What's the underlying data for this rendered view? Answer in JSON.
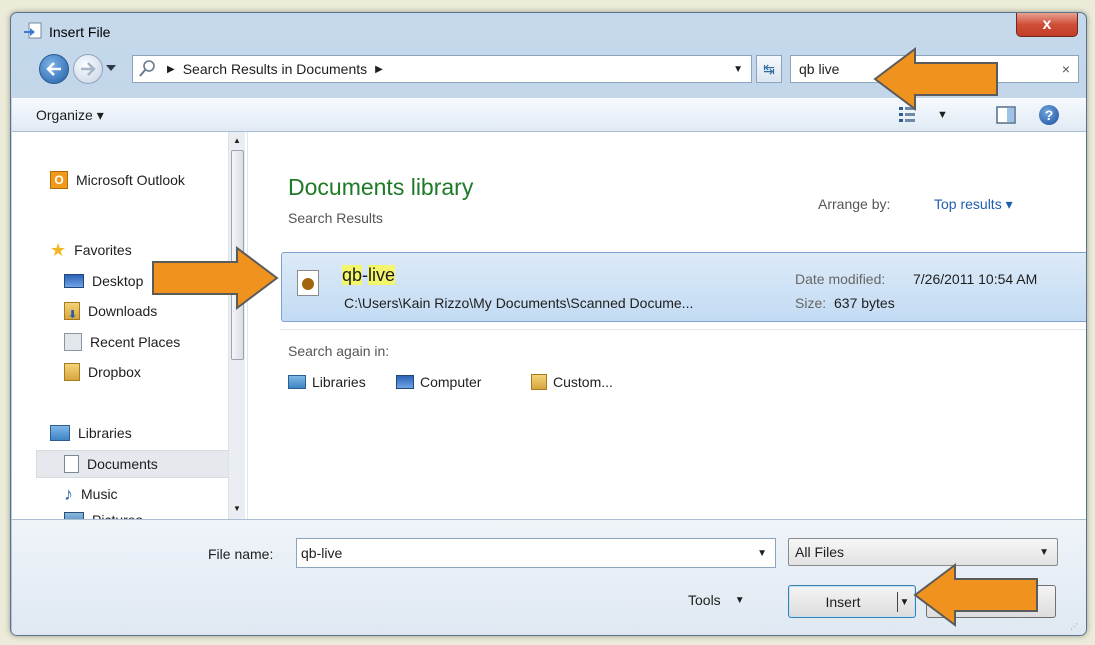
{
  "window": {
    "title": "Insert File",
    "close_glyph": "x"
  },
  "address": {
    "segment": "Search Results in Documents"
  },
  "search": {
    "value": "qb live",
    "clear_glyph": "×"
  },
  "toolbar": {
    "organize_label": "Organize ▾"
  },
  "nav": {
    "items": [
      {
        "label": "Microsoft Outlook",
        "icon": "outlook-icon"
      },
      {
        "label": "Favorites",
        "icon": "star-icon"
      },
      {
        "label": "Desktop",
        "icon": "desktop-icon"
      },
      {
        "label": "Downloads",
        "icon": "downloads-icon"
      },
      {
        "label": "Recent Places",
        "icon": "recent-places-icon"
      },
      {
        "label": "Dropbox",
        "icon": "dropbox-icon"
      },
      {
        "label": "Libraries",
        "icon": "libraries-icon"
      },
      {
        "label": "Documents",
        "icon": "documents-icon"
      },
      {
        "label": "Music",
        "icon": "music-icon"
      },
      {
        "label": "Pictures",
        "icon": "pictures-icon"
      }
    ]
  },
  "library": {
    "title": "Documents library",
    "subtitle": "Search Results",
    "arrange_label": "Arrange by:",
    "arrange_value": "Top results ▾"
  },
  "result": {
    "name_part1": "qb",
    "name_sep": "-",
    "name_part2": "live",
    "path": "C:\\Users\\Kain Rizzo\\My Documents\\Scanned Docume...",
    "date_label": "Date modified:",
    "date_value": "7/26/2011 10:54 AM",
    "size_label": "Size:",
    "size_value": "637 bytes"
  },
  "search_again": {
    "label": "Search again in:",
    "options": [
      "Libraries",
      "Computer",
      "Custom..."
    ]
  },
  "bottom": {
    "filename_label": "File name:",
    "filename_value": "qb-live",
    "filetype_value": "All Files",
    "tools_label": "Tools",
    "insert_label": "Insert"
  },
  "colors": {
    "accent": "#1e7a27",
    "arrow": "#f0921e",
    "highlight": "#f3f56a"
  }
}
